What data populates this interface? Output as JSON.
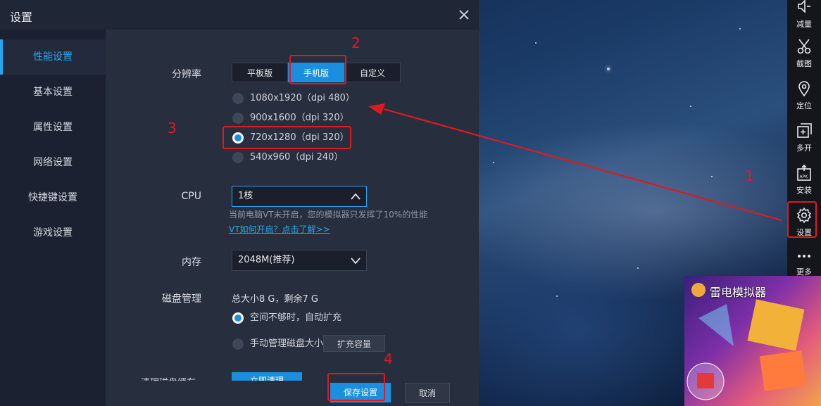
{
  "dialog": {
    "title": "设置",
    "sidebar": [
      "性能设置",
      "基本设置",
      "属性设置",
      "网络设置",
      "快捷键设置",
      "游戏设置"
    ],
    "active_tab": "性能设置"
  },
  "resolution": {
    "label": "分辨率",
    "tabs": [
      "平板版",
      "手机版",
      "自定义"
    ],
    "active_tab": "手机版",
    "options": [
      "1080x1920（dpi 480）",
      "900x1600（dpi 320）",
      "720x1280（dpi 320）",
      "540x960（dpi 240）"
    ],
    "selected": "720x1280（dpi 320）"
  },
  "cpu": {
    "label": "CPU",
    "value": "1核",
    "hint": "当前电脑VT未开启，您的模拟器只发挥了10%的性能",
    "link": "VT如何开启？点击了解>>"
  },
  "memory": {
    "label": "内存",
    "value": "2048M(推荐)"
  },
  "disk": {
    "label": "磁盘管理",
    "summary": "总大小8 G，剩余7 G",
    "options": [
      "空间不够时，自动扩充",
      "手动管理磁盘大小"
    ],
    "selected": "空间不够时，自动扩充",
    "expand_button": "扩充容量"
  },
  "cache": {
    "label": "清理磁盘缓存",
    "button": "立即清理"
  },
  "footer": {
    "save": "保存设置",
    "cancel": "取消"
  },
  "toolbar": [
    {
      "label": "减量",
      "icon": "volume-down-icon"
    },
    {
      "label": "截图",
      "icon": "scissors-icon"
    },
    {
      "label": "定位",
      "icon": "location-pin-icon"
    },
    {
      "label": "多开",
      "icon": "multi-instance-icon"
    },
    {
      "label": "安装",
      "icon": "apk-install-icon"
    },
    {
      "label": "设置",
      "icon": "gear-icon"
    },
    {
      "label": "更多",
      "icon": "more-dots-icon"
    }
  ],
  "ad": {
    "title": "雷电模拟器"
  },
  "annotations": [
    "1",
    "2",
    "3",
    "4"
  ],
  "colors": {
    "accent": "#1a8fe0",
    "annotation": "#e0191f",
    "panel": "#272e3e",
    "sidebar": "#1b2130"
  }
}
